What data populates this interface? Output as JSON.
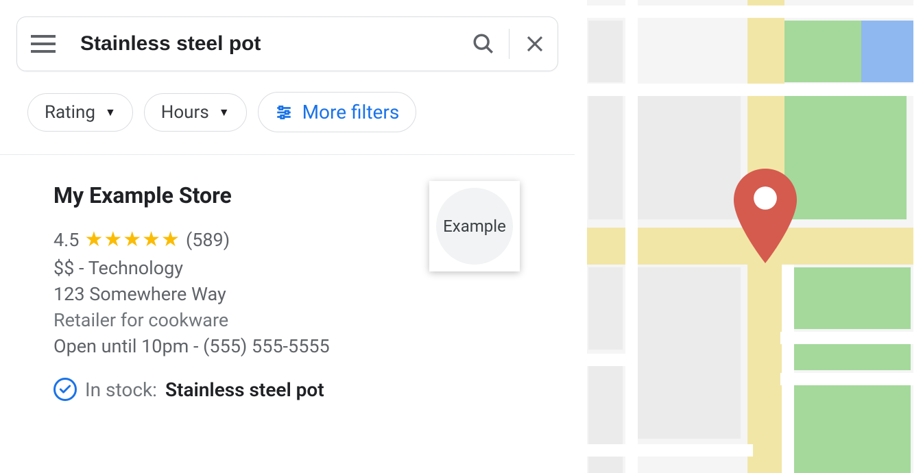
{
  "search": {
    "query": "Stainless steel pot"
  },
  "filters": {
    "rating_label": "Rating",
    "hours_label": "Hours",
    "more_label": "More filters"
  },
  "listing": {
    "name": "My Example Store",
    "rating": "4.5",
    "stars": "★★★★★",
    "review_count": "(589)",
    "price": "$$",
    "separator": " - ",
    "category": "Technology",
    "address": "123 Somewhere Way",
    "description": "Retailer for cookware",
    "hours": "Open until 10pm",
    "hp_separator": " - ",
    "phone": "(555) 555-5555",
    "instock_label": "In stock:",
    "instock_product": "Stainless steel pot",
    "thumb_text": "Example"
  },
  "colors": {
    "accent_blue": "#1a73e8",
    "star_yellow": "#fbbc04",
    "pin_red": "#d55b4e"
  }
}
